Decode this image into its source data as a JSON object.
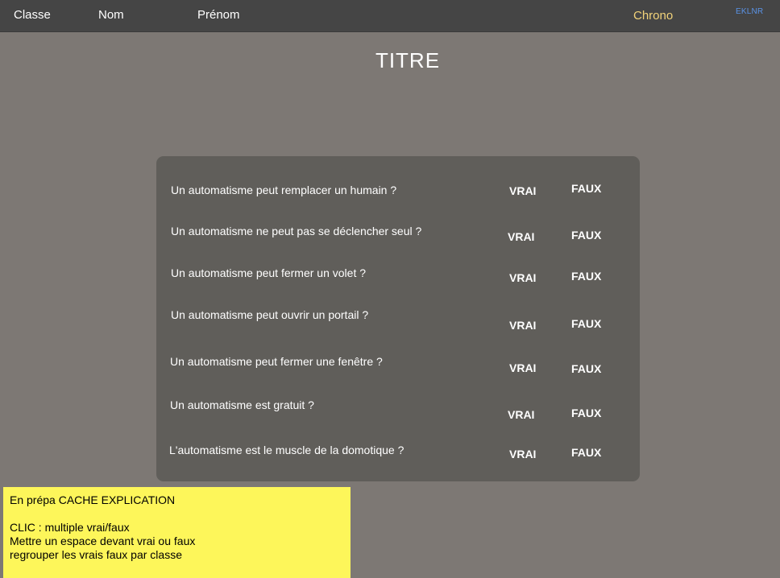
{
  "header": {
    "classe_label": "Classe",
    "nom_label": "Nom",
    "prenom_label": "Prénom",
    "chrono_label": "Chrono",
    "code_label": "EKLNR",
    "colors": {
      "bar": "#454545",
      "chrono": "#f2d37a",
      "code": "#5a93e6"
    }
  },
  "main": {
    "title": "TITRE"
  },
  "quiz": {
    "questions": [
      {
        "text": "Un automatisme peut remplacer un humain ?",
        "vrai": "VRAI",
        "faux": "FAUX"
      },
      {
        "text": "Un automatisme ne peut pas se déclencher seul ?",
        "vrai": "VRAI",
        "faux": "FAUX"
      },
      {
        "text": "Un automatisme peut fermer un volet ?",
        "vrai": "VRAI",
        "faux": "FAUX"
      },
      {
        "text": "Un automatisme peut ouvrir un portail ?",
        "vrai": "VRAI",
        "faux": "FAUX"
      },
      {
        "text": "Un automatisme peut fermer une fenêtre ?",
        "vrai": "VRAI",
        "faux": "FAUX"
      },
      {
        "text": "Un automatisme est gratuit ?",
        "vrai": "VRAI",
        "faux": "FAUX"
      },
      {
        "text": "L'automatisme est le muscle de la domotique ?",
        "vrai": "VRAI",
        "faux": "FAUX"
      }
    ]
  },
  "note": {
    "lines": [
      "En prépa CACHE EXPLICATION",
      "CLIC :  multiple vrai/faux",
      "Mettre un espace devant vrai ou faux",
      "regrouper les vrais faux par classe"
    ],
    "background": "#fdf65a"
  }
}
